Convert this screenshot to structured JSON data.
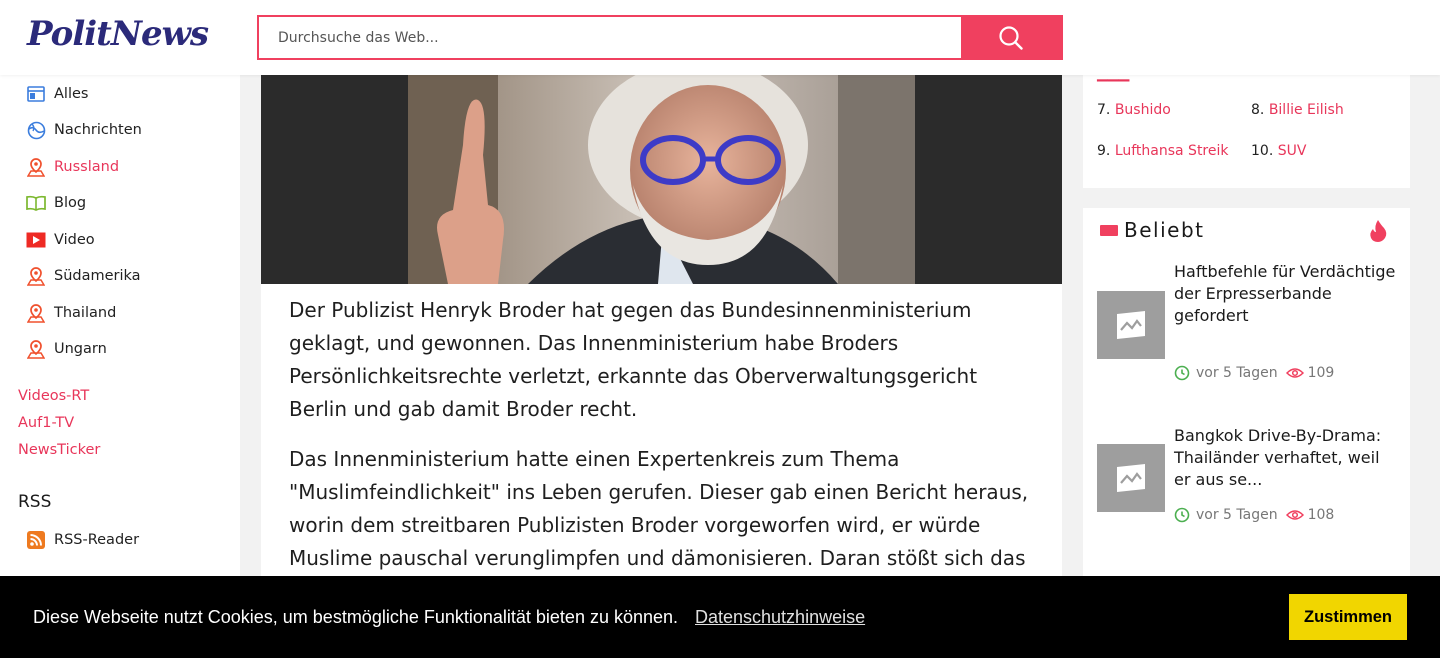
{
  "header": {
    "logo": "PolitNews",
    "search_placeholder": "Durchsuche das Web..."
  },
  "sidebar": {
    "items": [
      {
        "label": "Alles",
        "icon": "layout-icon"
      },
      {
        "label": "Nachrichten",
        "icon": "globe-icon"
      },
      {
        "label": "Russland",
        "icon": "map-pin-icon",
        "active": true
      },
      {
        "label": "Blog",
        "icon": "book-icon"
      },
      {
        "label": "Video",
        "icon": "video-icon"
      },
      {
        "label": "Südamerika",
        "icon": "map-pin-icon"
      },
      {
        "label": "Thailand",
        "icon": "map-pin-icon"
      },
      {
        "label": "Ungarn",
        "icon": "map-pin-icon"
      }
    ],
    "links": [
      "Videos-RT",
      "Auf1-TV",
      "NewsTicker"
    ],
    "rss_heading": "RSS",
    "rss_reader": "RSS-Reader"
  },
  "article": {
    "paragraphs": [
      "Der Publizist Henryk Broder hat gegen das Bundesinnenministerium geklagt, und gewonnen. Das Innenministerium habe Broders Persönlichkeitsrechte verletzt, erkannte das Oberverwaltungsgericht Berlin und gab damit Broder recht.",
      "Das Innenministerium hatte einen Expertenkreis zum Thema \"Muslimfeindlichkeit\" ins Leben gerufen. Dieser gab einen Bericht heraus, worin dem streitbaren Publizisten Broder vorgeworfen wird, er würde Muslime pauschal verunglimpfen und dämonisieren. Daran stößt sich das"
    ]
  },
  "trends": [
    {
      "num": "7.",
      "term": "Bushido"
    },
    {
      "num": "8.",
      "term": "Billie Eilish"
    },
    {
      "num": "9.",
      "term": "Lufthansa Streik"
    },
    {
      "num": "10.",
      "term": "SUV"
    }
  ],
  "popular": {
    "title": "Beliebt",
    "items": [
      {
        "title": "Haftbefehle für Verdächtige der Erpresserbande gefordert",
        "time": "vor 5 Tagen",
        "views": "109"
      },
      {
        "title": "Bangkok Drive-By-Drama: Thailänder verhaftet, weil er aus se...",
        "time": "vor 5 Tagen",
        "views": "108"
      }
    ]
  },
  "cookie": {
    "message": "Diese Webseite nutzt Cookies, um bestmögliche Funktionalität bieten zu können.",
    "link": "Datenschutzhinweise",
    "button": "Zustimmen"
  },
  "colors": {
    "accent": "#f0405f",
    "logo": "#2b2a7a",
    "cookie_button": "#f1d600"
  }
}
